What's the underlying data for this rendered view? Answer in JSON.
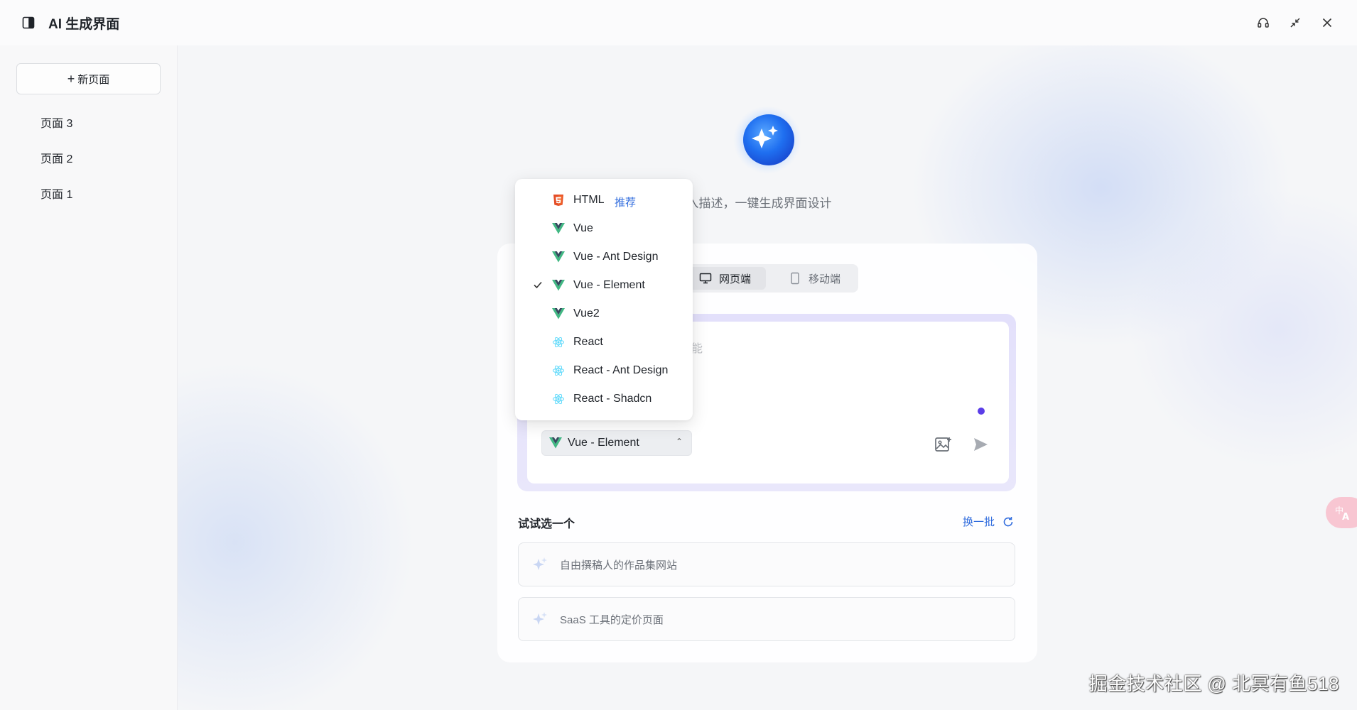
{
  "app": {
    "title": "AI 生成界面"
  },
  "window_controls": [
    "headset-icon",
    "minimize-arrows-icon",
    "close-icon"
  ],
  "sidebar": {
    "new_page_label": "新页面",
    "pages": [
      {
        "label": "页面 3"
      },
      {
        "label": "页面 2"
      },
      {
        "label": "页面 1"
      }
    ]
  },
  "main": {
    "subtitle": "输入描述，一键生成界面设计",
    "platform_tabs": [
      {
        "label": "网页端",
        "icon": "monitor-icon",
        "active": true
      },
      {
        "label": "移动端",
        "icon": "mobile-icon",
        "active": false
      }
    ],
    "input": {
      "placeholder_visible": "能"
    },
    "framework_select": {
      "value": "Vue - Element"
    },
    "try_section": {
      "title": "试试选一个",
      "refresh_label": "换一批",
      "suggestions": [
        {
          "text": "自由撰稿人的作品集网站"
        },
        {
          "text": "SaaS 工具的定价页面"
        }
      ]
    }
  },
  "dropdown": {
    "options": [
      {
        "label": "HTML",
        "icon": "html5-icon",
        "tag": "推荐",
        "selected": false
      },
      {
        "label": "Vue",
        "icon": "vue-icon",
        "selected": false
      },
      {
        "label": "Vue - Ant Design",
        "icon": "vue-icon",
        "selected": false
      },
      {
        "label": "Vue - Element",
        "icon": "vue-icon",
        "selected": true
      },
      {
        "label": "Vue2",
        "icon": "vue-icon",
        "selected": false
      },
      {
        "label": "React",
        "icon": "react-icon",
        "selected": false
      },
      {
        "label": "React - Ant Design",
        "icon": "react-icon",
        "selected": false
      },
      {
        "label": "React - Shadcn",
        "icon": "react-icon",
        "selected": false
      }
    ]
  },
  "watermark": "掘金技术社区 @ 北冥有鱼518",
  "colors": {
    "accent": "#2f6bdd",
    "vue_green": "#41b883",
    "vue_dark": "#35495e",
    "react": "#61dafb",
    "html": "#e44d26",
    "mic_dot": "#5b3ee8"
  }
}
